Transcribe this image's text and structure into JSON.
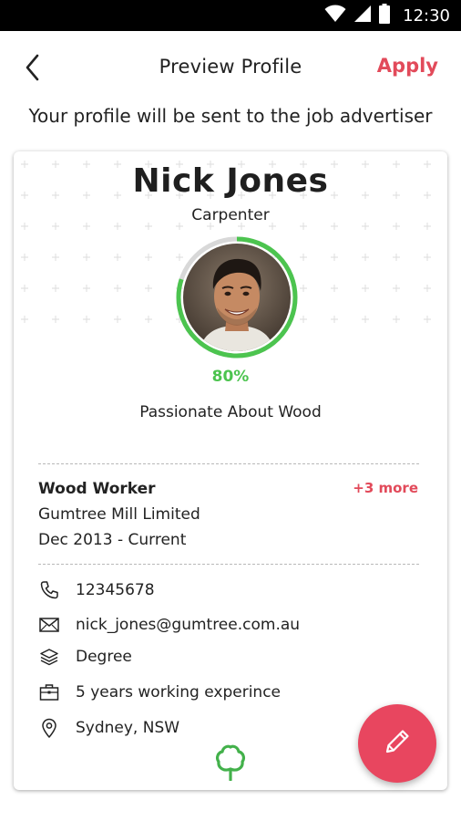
{
  "status_bar": {
    "time": "12:30",
    "icons": [
      "wifi-icon",
      "signal-icon",
      "battery-icon"
    ]
  },
  "header": {
    "back_icon": "chevron-left-icon",
    "title": "Preview Profile",
    "apply_label": "Apply"
  },
  "subtitle": "Your profile will be sent to the job advertiser",
  "profile": {
    "name": "Nick Jones",
    "role": "Carpenter",
    "completion_percent": 80,
    "completion_label": "80%",
    "tagline": "Passionate About Wood"
  },
  "experience": {
    "title": "Wood Worker",
    "more_label": "+3 more",
    "company": "Gumtree Mill Limited",
    "dates": "Dec 2013 - Current"
  },
  "details": [
    {
      "icon": "phone-icon",
      "text": "12345678"
    },
    {
      "icon": "mail-icon",
      "text": "nick_jones@gumtree.com.au"
    },
    {
      "icon": "education-icon",
      "text": "Degree"
    },
    {
      "icon": "briefcase-icon",
      "text": "5 years working experince"
    },
    {
      "icon": "location-pin-icon",
      "text": "Sydney, NSW"
    }
  ],
  "colors": {
    "accent_red": "#e24a5a",
    "progress_green": "#4cc44f",
    "progress_track": "#d8d8d8",
    "brand_green": "#43b14b",
    "fab_red": "#e8465f"
  },
  "fab_icon": "edit-pencil-icon",
  "brand_logo": "gumtree-logo-icon"
}
